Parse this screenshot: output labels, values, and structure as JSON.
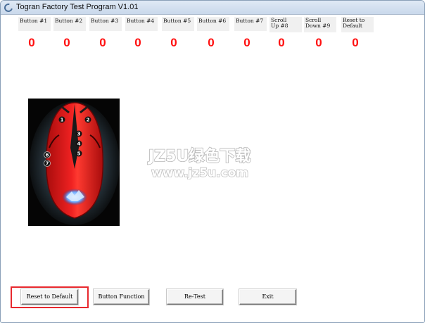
{
  "window": {
    "title": "Togran Factory Test Program V1.01"
  },
  "columns": [
    {
      "label": "Button #1",
      "count": "0"
    },
    {
      "label": "Button #2",
      "count": "0"
    },
    {
      "label": "Button #3",
      "count": "0"
    },
    {
      "label": "Button #4",
      "count": "0"
    },
    {
      "label": "Button #5",
      "count": "0"
    },
    {
      "label": "Button #6",
      "count": "0"
    },
    {
      "label": "Button #7",
      "count": "0"
    },
    {
      "label": "Scroll\nUp #8",
      "count": "0"
    },
    {
      "label": "Scroll\nDown #9",
      "count": "0"
    },
    {
      "label": "Reset to\nDefault",
      "count": "0"
    }
  ],
  "buttons": {
    "reset_default": "Reset to Default",
    "button_function": "Button Function",
    "retest": "Re-Test",
    "exit": "Exit"
  },
  "watermark": {
    "line1": "JZ5U绿色下载",
    "line2": "www.jz5u.com"
  },
  "mouse_numbers": [
    "1",
    "2",
    "3",
    "4",
    "5",
    "6",
    "7"
  ],
  "colors": {
    "counter": "#ff1010",
    "highlight": "#e8282e",
    "mouse_body": "#e01818"
  }
}
